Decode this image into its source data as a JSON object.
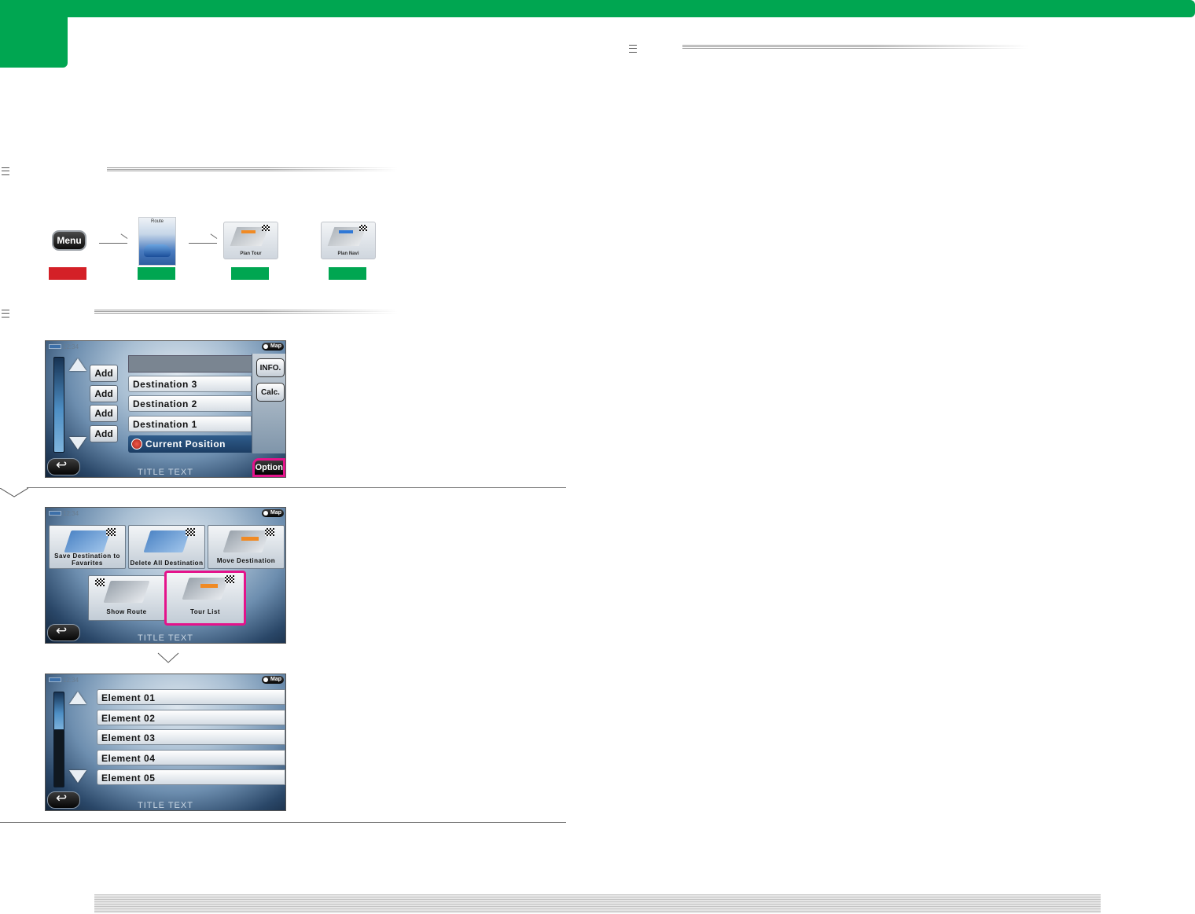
{
  "header": {
    "brand_color": "#00a651"
  },
  "steps": {
    "menu_label": "Menu",
    "route_label": "Route",
    "plan_tour_label": "Plan Tour",
    "plan_navi_label": "Plan Navi",
    "swatch_colors": [
      "#d42027",
      "#00a651",
      "#00a651",
      "#00a651"
    ]
  },
  "screen_destinations": {
    "clock": "12:34",
    "map_label": "Map",
    "add_buttons": [
      "Add",
      "Add",
      "Add",
      "Add"
    ],
    "destinations": [
      "Destination 3",
      "Destination 2",
      "Destination 1"
    ],
    "current_position": "Current Position",
    "info_label": "INFO.",
    "calc_label": "Calc.",
    "option_label": "Option",
    "title": "TITLE TEXT"
  },
  "screen_options": {
    "clock": "12:34",
    "map_label": "Map",
    "tiles": {
      "save": "Save Destination to Favarites",
      "delete": "Delete All Destination",
      "move": "Move Destination",
      "show_route": "Show Route",
      "tour_list": "Tour List"
    },
    "title": "TITLE TEXT",
    "highlight_color": "#e4138b"
  },
  "screen_tour_list": {
    "clock": "12:34",
    "map_label": "Map",
    "elements": [
      "Element 01",
      "Element 02",
      "Element 03",
      "Element 04",
      "Element 05"
    ],
    "title": "TITLE TEXT"
  }
}
